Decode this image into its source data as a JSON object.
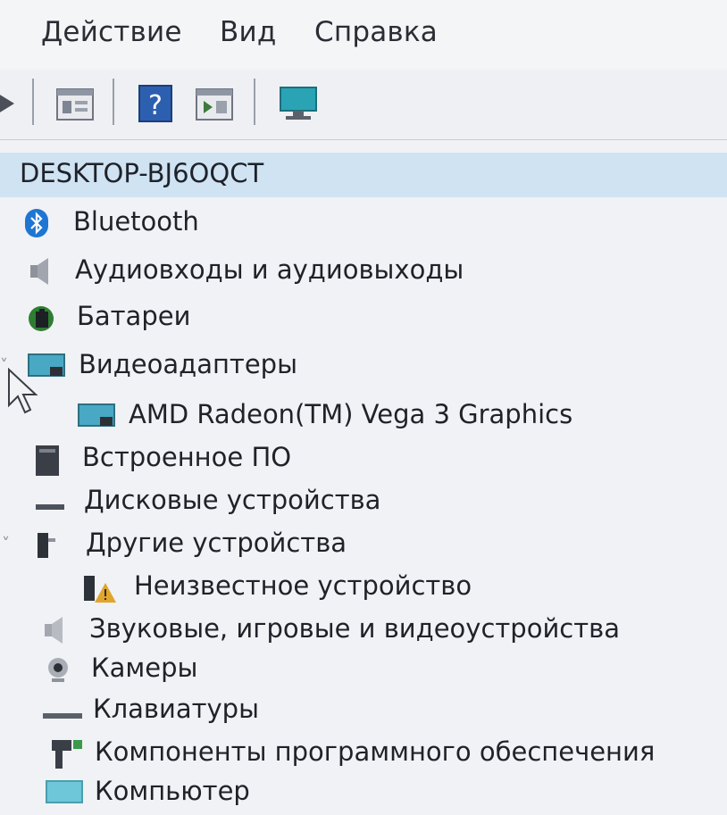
{
  "menu": {
    "items": [
      "Действие",
      "Вид",
      "Справка"
    ]
  },
  "toolbar": {
    "buttons": [
      "forward-icon",
      "properties-icon",
      "help-icon",
      "view-icon",
      "monitor-icon"
    ]
  },
  "tree": {
    "root": "DESKTOP-BJ6OQCT",
    "items": [
      {
        "label": "Bluetooth",
        "icon": "bluetooth-icon"
      },
      {
        "label": "Аудиовходы и аудиовыходы",
        "icon": "speaker-icon"
      },
      {
        "label": "Батареи",
        "icon": "battery-icon"
      },
      {
        "label": "Видеоадаптеры",
        "icon": "display-adapter-icon"
      },
      {
        "label": "AMD Radeon(TM) Vega 3 Graphics",
        "icon": "display-adapter-icon"
      },
      {
        "label": "Встроенное ПО",
        "icon": "firmware-icon"
      },
      {
        "label": "Дисковые устройства",
        "icon": "disk-icon"
      },
      {
        "label": "Другие устройства",
        "icon": "other-device-icon"
      },
      {
        "label": "Неизвестное устройство",
        "icon": "unknown-device-warning-icon"
      },
      {
        "label": "Звуковые, игровые и видеоустройства",
        "icon": "sound-icon"
      },
      {
        "label": "Камеры",
        "icon": "camera-icon"
      },
      {
        "label": "Клавиатуры",
        "icon": "keyboard-icon"
      },
      {
        "label": "Компоненты программного обеспечения",
        "icon": "software-component-icon"
      },
      {
        "label": "Компьютер",
        "icon": "computer-icon"
      }
    ]
  }
}
